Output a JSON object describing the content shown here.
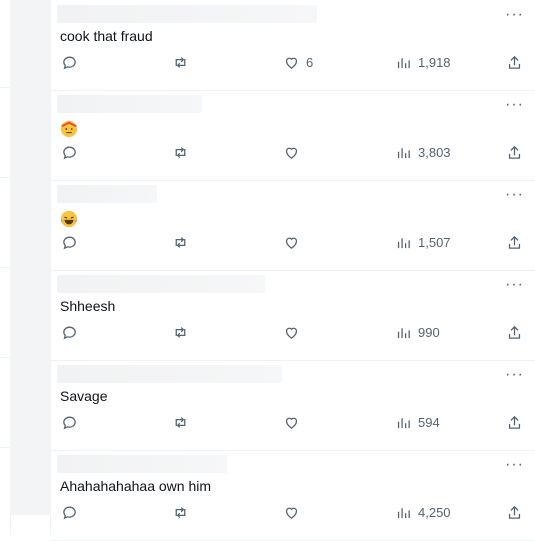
{
  "tweets": [
    {
      "text": "cook that fraud",
      "emoji": "",
      "likes": "6",
      "views": "1,918"
    },
    {
      "text": "",
      "emoji": "shy-face",
      "likes": "",
      "views": "3,803"
    },
    {
      "text": "",
      "emoji": "laughing-crying-face",
      "likes": "",
      "views": "1,507"
    },
    {
      "text": "Shheesh",
      "emoji": "",
      "likes": "",
      "views": "990"
    },
    {
      "text": "Savage",
      "emoji": "",
      "likes": "",
      "views": "594"
    },
    {
      "text": "Ahahahahahaa own him",
      "emoji": "",
      "likes": "",
      "views": "4,250"
    }
  ],
  "colors": {
    "icon": "#536471",
    "text": "#0f1419",
    "divider": "#eff3f4"
  }
}
